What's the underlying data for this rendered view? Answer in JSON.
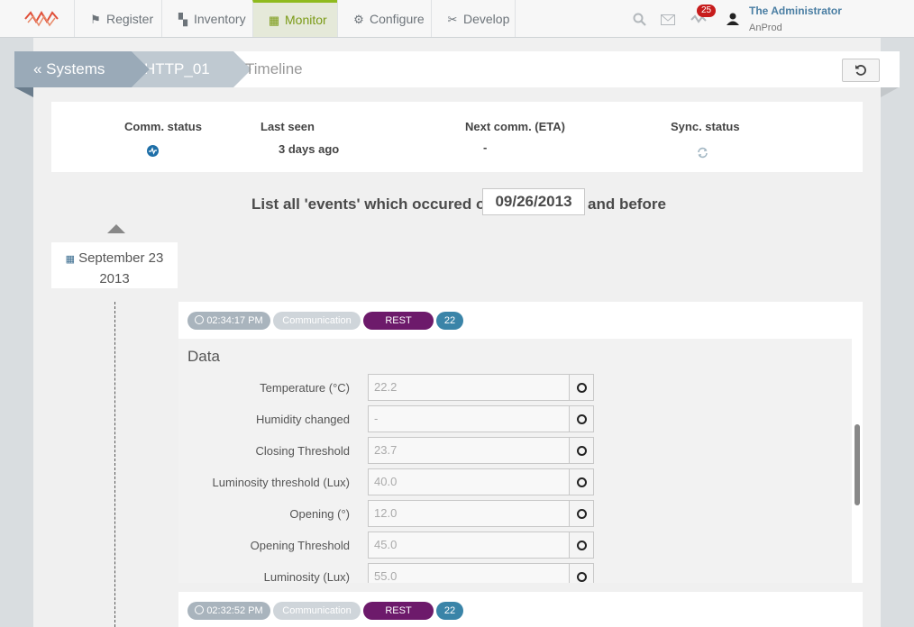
{
  "nav": {
    "tabs": [
      {
        "label": "Register",
        "icon": "flag-icon"
      },
      {
        "label": "Inventory",
        "icon": "box-icon"
      },
      {
        "label": "Monitor",
        "icon": "monitor-icon"
      },
      {
        "label": "Configure",
        "icon": "gear-icon"
      },
      {
        "label": "Develop",
        "icon": "tools-icon"
      }
    ],
    "active_tab": "Monitor",
    "notifications_count": "25",
    "user_name": "The Administrator",
    "user_org": "AnProd",
    "accent_color": "#8fba1e"
  },
  "breadcrumb": {
    "systems": "« Systems",
    "device": "HTTP_01",
    "current": "Timeline"
  },
  "status": {
    "comm_label": "Comm. status",
    "last_seen_label": "Last seen",
    "last_seen_value": "3 days ago",
    "next_comm_label": "Next comm. (ETA)",
    "next_comm_value": "-",
    "sync_label": "Sync. status"
  },
  "filter": {
    "prefix": "List all 'events' which occured on",
    "date": "09/26/2013",
    "suffix": "and before"
  },
  "timeline": {
    "date_line1": "September 23",
    "date_line2": "2013"
  },
  "events": [
    {
      "time": "02:34:17 PM",
      "type": "Communication",
      "protocol": "REST",
      "count": "22",
      "data_title": "Data",
      "fields": [
        {
          "label": "Temperature (°C)",
          "value": "22.2"
        },
        {
          "label": "Humidity changed",
          "value": "-"
        },
        {
          "label": "Closing Threshold",
          "value": "23.7"
        },
        {
          "label": "Luminosity threshold (Lux)",
          "value": "40.0"
        },
        {
          "label": "Opening (°)",
          "value": "12.0"
        },
        {
          "label": "Opening Threshold",
          "value": "45.0"
        },
        {
          "label": "Luminosity (Lux)",
          "value": "55.0"
        }
      ]
    },
    {
      "time": "02:32:52 PM",
      "type": "Communication",
      "protocol": "REST",
      "count": "22"
    }
  ]
}
